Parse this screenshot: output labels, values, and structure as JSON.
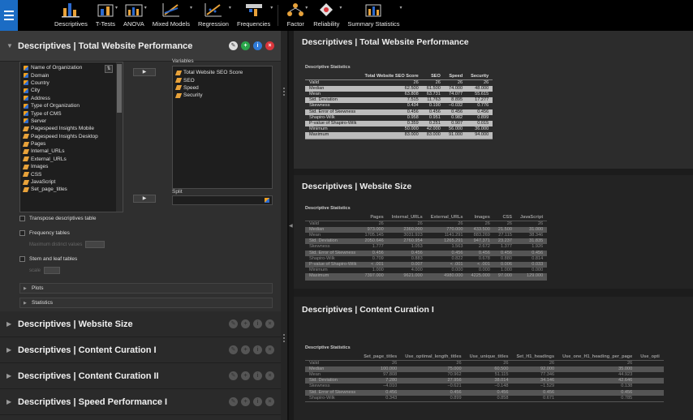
{
  "ribbon": {
    "buttons": [
      {
        "label": "Descriptives",
        "icon": "descriptives-icon"
      },
      {
        "label": "T-Tests",
        "icon": "ttests-icon"
      },
      {
        "label": "ANOVA",
        "icon": "anova-icon"
      },
      {
        "label": "Mixed Models",
        "icon": "mixed-models-icon"
      },
      {
        "label": "Regression",
        "icon": "regression-icon"
      },
      {
        "label": "Frequencies",
        "icon": "frequencies-icon"
      },
      {
        "label": "Factor",
        "icon": "factor-icon"
      },
      {
        "label": "Reliability",
        "icon": "reliability-icon"
      },
      {
        "label": "Summary Statistics",
        "icon": "summary-statistics-icon"
      }
    ],
    "colors": {
      "accent": "#1b6cc4",
      "icon_orange": "#e8a23a",
      "icon_blue": "#2d6bcf"
    }
  },
  "left": {
    "open_analysis": {
      "title": "Descriptives | Total Website Performance",
      "variables_source": [
        {
          "name": "Name of Organization",
          "type": "nominal"
        },
        {
          "name": "Domain",
          "type": "nominal"
        },
        {
          "name": "Country",
          "type": "nominal"
        },
        {
          "name": "City",
          "type": "nominal"
        },
        {
          "name": "Address",
          "type": "nominal"
        },
        {
          "name": "Type of Organization",
          "type": "nominal"
        },
        {
          "name": "Type of CMS",
          "type": "nominal"
        },
        {
          "name": "Server",
          "type": "nominal"
        },
        {
          "name": "Pagespeed Insights Mobile",
          "type": "scale"
        },
        {
          "name": "Pagespeed Insights Desktop",
          "type": "scale"
        },
        {
          "name": "Pages",
          "type": "scale"
        },
        {
          "name": "Internal_URLs",
          "type": "scale"
        },
        {
          "name": "External_URLs",
          "type": "scale"
        },
        {
          "name": "Images",
          "type": "scale"
        },
        {
          "name": "CSS",
          "type": "scale"
        },
        {
          "name": "JavaScript",
          "type": "scale"
        },
        {
          "name": "Set_page_titles",
          "type": "scale"
        }
      ],
      "variables_label": "Variables",
      "variables_selected": [
        {
          "name": "Total Website SEO Score"
        },
        {
          "name": "SEO"
        },
        {
          "name": "Speed"
        },
        {
          "name": "Security"
        }
      ],
      "split_label": "Split",
      "arrow": "▶",
      "transpose_label": "Transpose descriptives table",
      "frequency_tables_label": "Frequency tables",
      "max_distinct_label": "Maximum distinct values",
      "stem_leaf_label": "Stem and leaf tables",
      "scale_label": "scale",
      "plots_label": "Plots",
      "statistics_label": "Statistics"
    },
    "collapsed": [
      {
        "title": "Descriptives | Website Size"
      },
      {
        "title": "Descriptives | Content Curation I"
      },
      {
        "title": "Descriptives | Content Curation II"
      },
      {
        "title": "Descriptives | Speed Performance I"
      }
    ]
  },
  "output": {
    "table_caption": "Descriptive Statistics",
    "blocks": [
      {
        "title": "Descriptives | Total Website Performance",
        "columns": [
          "",
          "Total Website SEO Score",
          "SEO",
          "Speed",
          "Security"
        ],
        "rows": [
          [
            "Valid",
            "26",
            "26",
            "26",
            "26"
          ],
          [
            "Median",
            "62.500",
            "61.500",
            "74.000",
            "48.000"
          ],
          [
            "Mean",
            "63.808",
            "63.731",
            "74.077",
            "55.615"
          ],
          [
            "Std. Deviation",
            "7.515",
            "11.763",
            "8.895",
            "17.277"
          ],
          [
            "Skewness",
            "0.434",
            "0.190",
            "−0.032",
            "0.776"
          ],
          [
            "Std. Error of Skewness",
            "0.456",
            "0.456",
            "0.456",
            "0.456"
          ],
          [
            "Shapiro-Wilk",
            "0.958",
            "0.951",
            "0.982",
            "0.899"
          ],
          [
            "P-value of Shapiro-Wilk",
            "0.359",
            "0.251",
            "0.907",
            "0.015"
          ],
          [
            "Minimum",
            "50.000",
            "42.000",
            "56.000",
            "36.000"
          ],
          [
            "Maximum",
            "83.000",
            "83.000",
            "91.000",
            "94.000"
          ]
        ]
      },
      {
        "title": "Descriptives | Website Size",
        "columns": [
          "",
          "Pages",
          "Internal_URLs",
          "External_URLs",
          "Images",
          "CSS",
          "JavaScript"
        ],
        "rows": [
          [
            "Valid",
            "26",
            "26",
            "26",
            "26",
            "26",
            "26"
          ],
          [
            "Median",
            "973.000",
            "2360.000",
            "770.000",
            "433.500",
            "21.500",
            "31.000"
          ],
          [
            "Mean",
            "1705.145",
            "3031.923",
            "1141.291",
            "883.269",
            "27.115",
            "38.346"
          ],
          [
            "Std. Deviation",
            "2050.646",
            "2760.954",
            "1265.291",
            "947.371",
            "23.237",
            "31.835"
          ],
          [
            "Skewness",
            "1.777",
            "1.053",
            "1.563",
            "2.672",
            "1.377",
            "1.926"
          ],
          [
            "Std. Error of Skewness",
            "0.456",
            "0.456",
            "0.456",
            "0.456",
            "0.456",
            "0.456"
          ],
          [
            "Shapiro-Wilk",
            "0.709",
            "0.883",
            "0.822",
            "0.678",
            "0.880",
            "0.814"
          ],
          [
            "P-value of Shapiro-Wilk",
            "< .001",
            "0.007",
            "< .001",
            "< .001",
            "0.006",
            "0.033"
          ],
          [
            "Minimum",
            "1.000",
            "4.000",
            "0.000",
            "0.000",
            "1.000",
            "0.000"
          ],
          [
            "Maximum",
            "7397.000",
            "9621.000",
            "4980.000",
            "4225.000",
            "97.000",
            "129.000"
          ]
        ]
      },
      {
        "title": "Descriptives | Content Curation I",
        "columns": [
          "",
          "Set_page_titles",
          "Use_optimal_length_titles",
          "Use_unique_titles",
          "Set_H1_headings",
          "Use_one_H1_heading_per_page",
          "Use_opti"
        ],
        "rows": [
          [
            "Valid",
            "26",
            "26",
            "26",
            "26",
            "26",
            ""
          ],
          [
            "Median",
            "100.000",
            "75.000",
            "60.500",
            "92.000",
            "35.000",
            ""
          ],
          [
            "Mean",
            "97.808",
            "70.962",
            "51.115",
            "77.346",
            "44.923",
            ""
          ],
          [
            "Std. Deviation",
            "7.280",
            "27.956",
            "38.014",
            "34.146",
            "42.646",
            ""
          ],
          [
            "Skewness",
            "−4.010",
            "−0.621",
            "−0.148",
            "−1.529",
            "0.138",
            ""
          ],
          [
            "Std. Error of Skewness",
            "0.456",
            "0.456",
            "0.456",
            "0.456",
            "0.456",
            ""
          ],
          [
            "Shapiro-Wilk",
            "0.343",
            "0.899",
            "0.858",
            "0.671",
            "0.785",
            ""
          ]
        ]
      }
    ]
  }
}
